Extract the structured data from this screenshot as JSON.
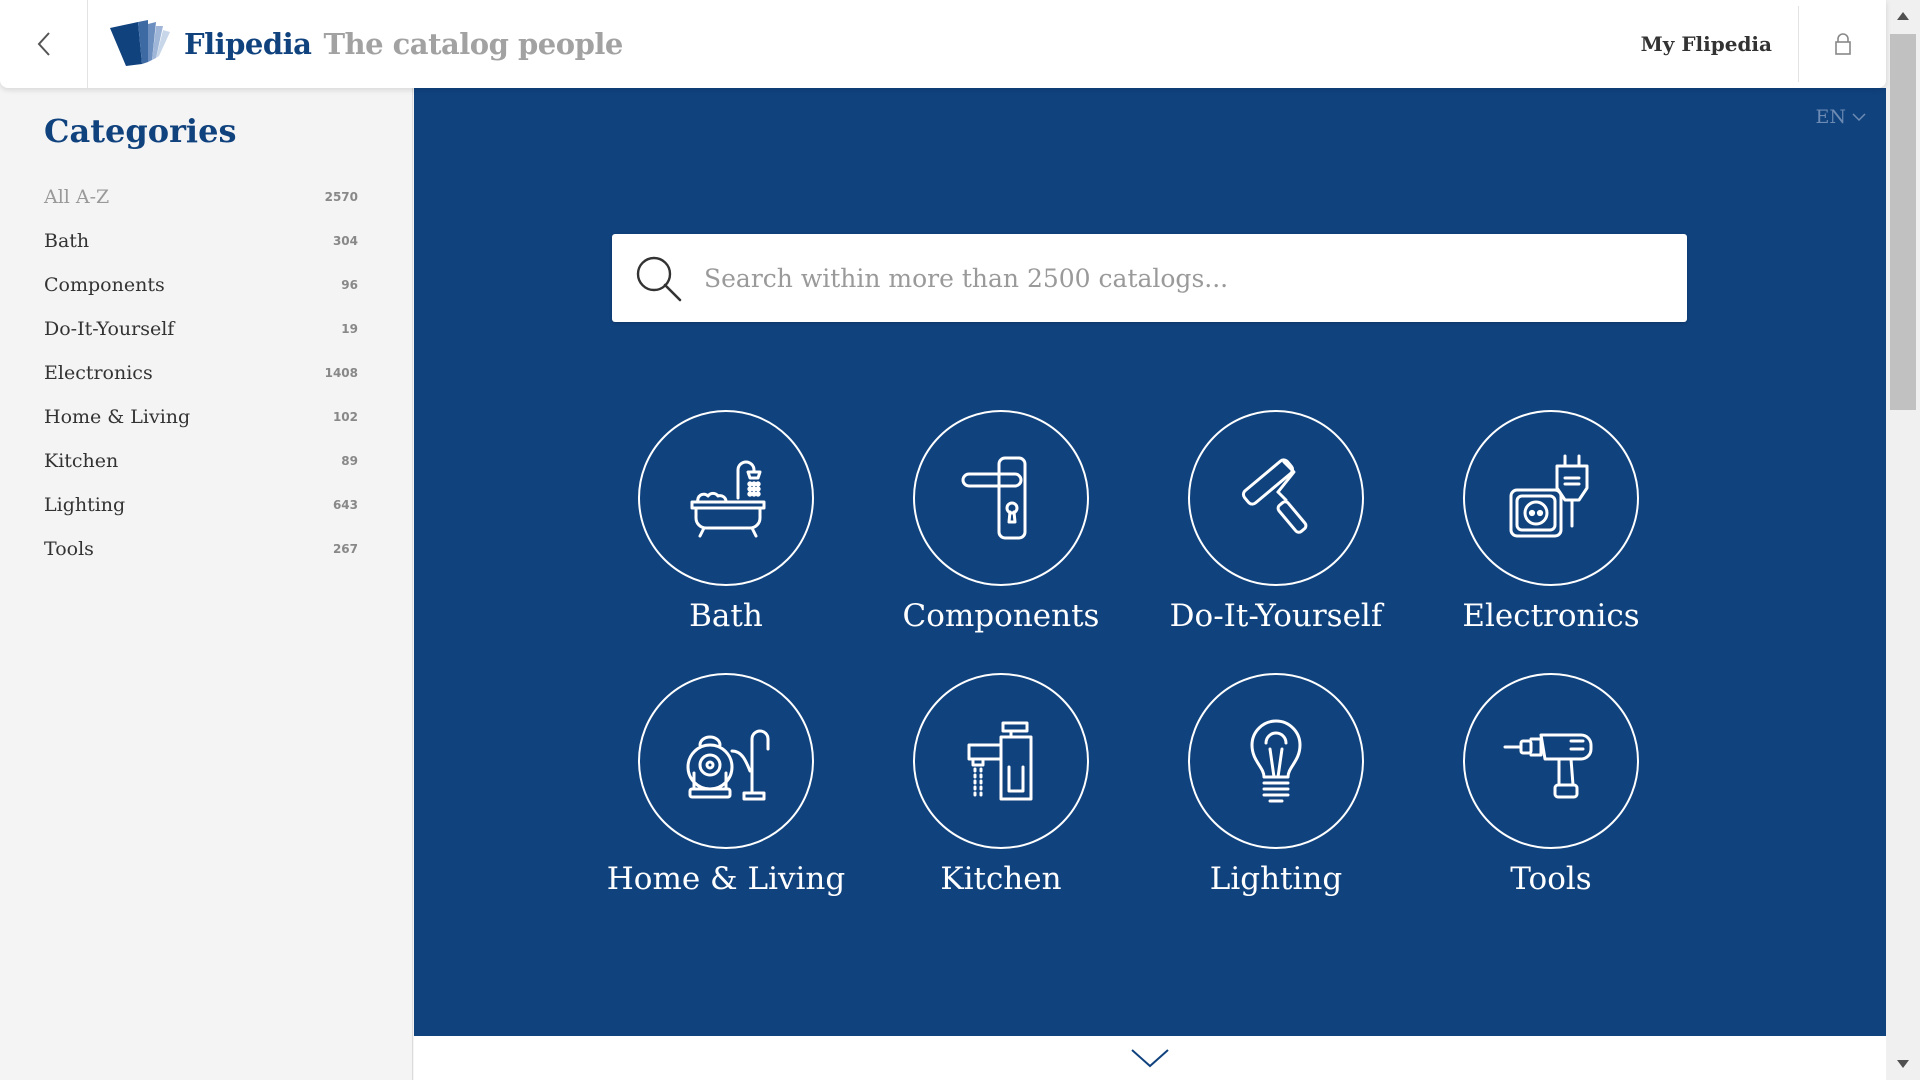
{
  "header": {
    "brand": "Flipedia",
    "tagline": "The catalog people",
    "my_flipedia_label": "My Flipedia",
    "back_icon": "chevron-left-icon",
    "lock_icon": "lock-icon"
  },
  "sidebar": {
    "title": "Categories",
    "items": [
      {
        "label": "All A-Z",
        "count": "2570"
      },
      {
        "label": "Bath",
        "count": "304"
      },
      {
        "label": "Components",
        "count": "96"
      },
      {
        "label": "Do-It-Yourself",
        "count": "19"
      },
      {
        "label": "Electronics",
        "count": "1408"
      },
      {
        "label": "Home & Living",
        "count": "102"
      },
      {
        "label": "Kitchen",
        "count": "89"
      },
      {
        "label": "Lighting",
        "count": "643"
      },
      {
        "label": "Tools",
        "count": "267"
      }
    ]
  },
  "main": {
    "language": "EN",
    "search_placeholder": "Search within more than 2500 catalogs...",
    "tiles": [
      {
        "label": "Bath",
        "icon": "bathtub-icon"
      },
      {
        "label": "Components",
        "icon": "door-handle-icon"
      },
      {
        "label": "Do-It-Yourself",
        "icon": "paint-roller-icon"
      },
      {
        "label": "Electronics",
        "icon": "power-socket-icon"
      },
      {
        "label": "Home & Living",
        "icon": "vacuum-cleaner-icon"
      },
      {
        "label": "Kitchen",
        "icon": "faucet-icon"
      },
      {
        "label": "Lighting",
        "icon": "light-bulb-icon"
      },
      {
        "label": "Tools",
        "icon": "drill-icon"
      }
    ]
  },
  "colors": {
    "brand_blue": "#10427e",
    "tagline_gray": "#a2a2a2",
    "sidebar_bg": "#f4f4f4"
  }
}
